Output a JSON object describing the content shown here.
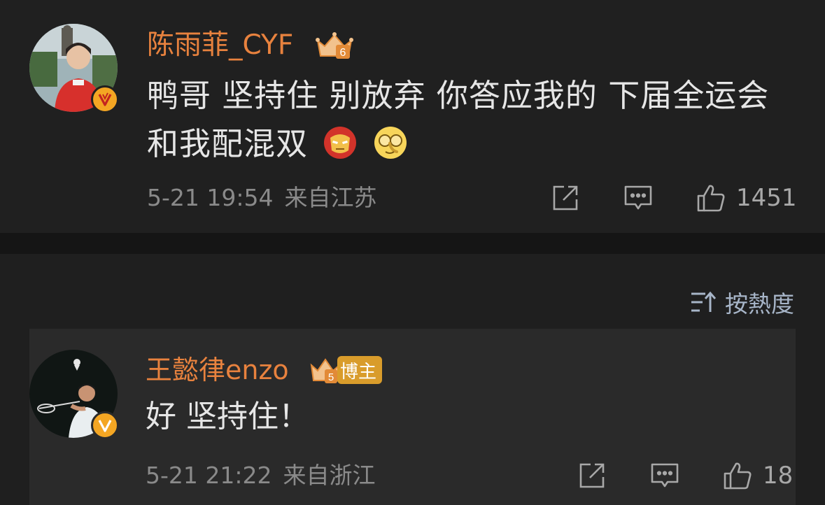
{
  "post": {
    "username": "陈雨菲_CYF",
    "level_badge_number": "6",
    "text": "鸭哥 坚持住 别放弃 你答应我的 下届全运会和我配混双",
    "emojis": [
      "iron-man-emoji",
      "covering-eyes-emoji"
    ],
    "date": "5-21 19:54",
    "location": "来自江苏",
    "like_count": "1451",
    "colors": {
      "username": "#e8823e",
      "badge": "#f4a623"
    }
  },
  "sort": {
    "label": "按熱度"
  },
  "reply": {
    "username": "王懿律enzo",
    "level_badge_number": "5",
    "role_badge": "博主",
    "text": "好 坚持住！",
    "date": "5-21 21:22",
    "location": "来自浙江",
    "like_count": "18"
  }
}
